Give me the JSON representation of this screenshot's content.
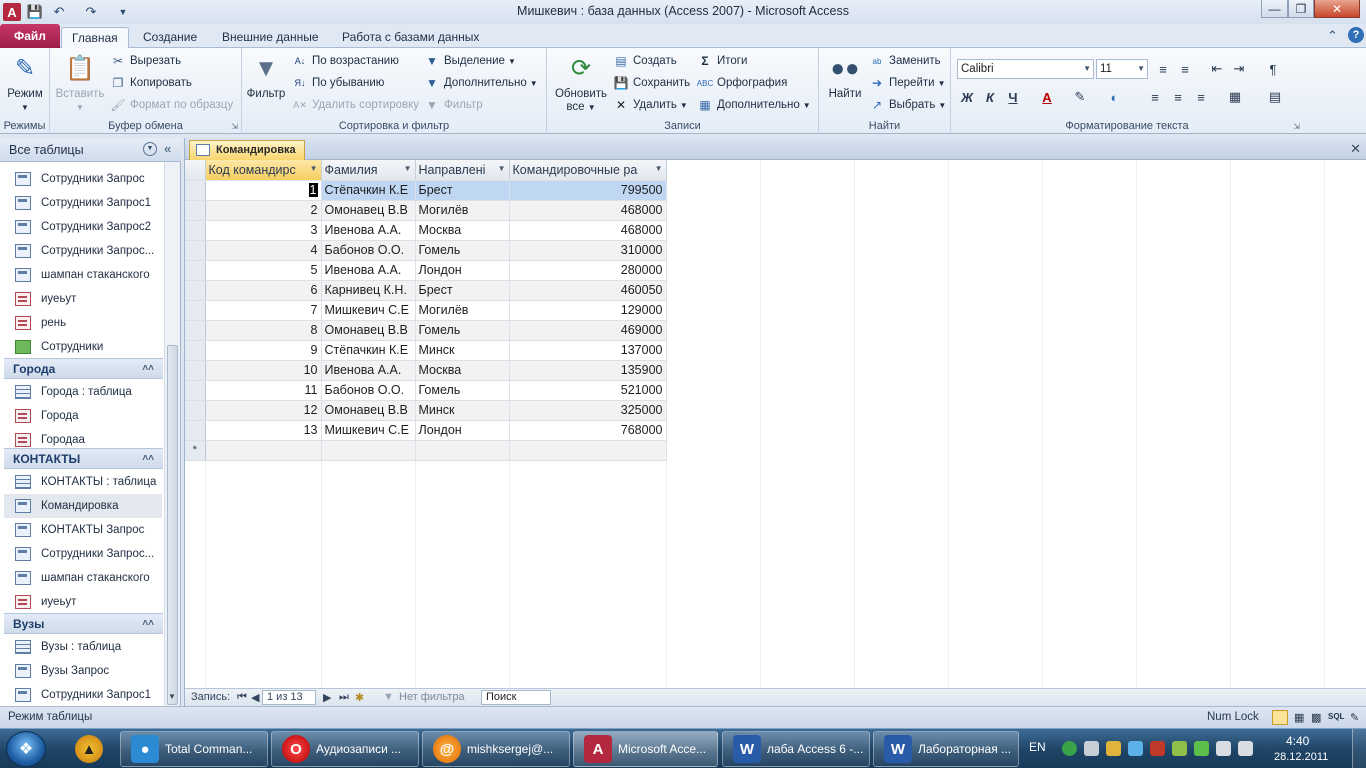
{
  "window": {
    "title": "Мишкевич : база данных (Access 2007)  -  Microsoft Access"
  },
  "tabs": [
    "Файл",
    "Главная",
    "Создание",
    "Внешние данные",
    "Работа с базами данных"
  ],
  "ribbon": {
    "groups": {
      "views": "Режимы",
      "clipboard": "Буфер обмена",
      "sort_filter": "Сортировка и фильтр",
      "records": "Записи",
      "find": "Найти",
      "text_format": "Форматирование текста"
    },
    "view_label": "Режим",
    "paste_label": "Вставить",
    "cut_label": "Вырезать",
    "copy_label": "Копировать",
    "format_painter_label": "Формат по образцу",
    "filter_label": "Фильтр",
    "ascending_label": "По возрастанию",
    "descending_label": "По убыванию",
    "remove_sort_label": "Удалить сортировку",
    "selection_label": "Выделение",
    "advanced_filter_label": "Дополнительно",
    "toggle_filter_label": "Фильтр",
    "refresh_label": "Обновить",
    "refresh_label2": "все",
    "new_label": "Создать",
    "save_label": "Сохранить",
    "delete_label": "Удалить",
    "totals_label": "Итоги",
    "spelling_label": "Орфография",
    "more_label": "Дополнительно",
    "find_label": "Найти",
    "replace_label": "Заменить",
    "goto_label": "Перейти",
    "select_label": "Выбрать",
    "font_name": "Calibri",
    "font_size": "11",
    "bold": "Ж",
    "italic": "К",
    "underline": "Ч",
    "font_color": "A"
  },
  "nav": {
    "header": "Все таблицы",
    "items_top": [
      {
        "label": "Сотрудники Запрос",
        "icon": "query"
      },
      {
        "label": "Сотрудники Запрос1",
        "icon": "query"
      },
      {
        "label": "Сотрудники Запрос2",
        "icon": "query"
      },
      {
        "label": "Сотрудники Запрос...",
        "icon": "query"
      },
      {
        "label": "шампан стаканского",
        "icon": "query"
      },
      {
        "label": "иуеьут",
        "icon": "form"
      },
      {
        "label": "рень",
        "icon": "form"
      },
      {
        "label": "Сотрудники",
        "icon": "report"
      }
    ],
    "group_goroda": "Города",
    "items_goroda": [
      {
        "label": "Города : таблица",
        "icon": "table"
      },
      {
        "label": "Города",
        "icon": "form"
      },
      {
        "label": "Городаа",
        "icon": "form"
      }
    ],
    "group_kontakty": "КОНТАКТЫ",
    "items_kontakty": [
      {
        "label": "КОНТАКТЫ : таблица",
        "icon": "table"
      },
      {
        "label": "Командировка",
        "icon": "query"
      },
      {
        "label": "КОНТАКТЫ Запрос",
        "icon": "query"
      },
      {
        "label": "Сотрудники Запрос...",
        "icon": "query"
      },
      {
        "label": "шампан стаканского",
        "icon": "query"
      },
      {
        "label": "иуеьут",
        "icon": "form"
      }
    ],
    "group_vuzy": "Вузы",
    "items_vuzy": [
      {
        "label": "Вузы : таблица",
        "icon": "table"
      },
      {
        "label": "Вузы Запрос",
        "icon": "query"
      },
      {
        "label": "Сотрудники Запрос1",
        "icon": "query"
      }
    ]
  },
  "doc": {
    "tab_title": "Командировка",
    "columns": [
      "Код командирс",
      "Фамилия",
      "Направлені",
      "Командировочные ра"
    ],
    "rows": [
      [
        "1",
        "Стёпачкин К.Е",
        "Брест",
        "799500"
      ],
      [
        "2",
        "Омонавец В.В",
        "Могилёв",
        "468000"
      ],
      [
        "3",
        "Ивенова А.А.",
        "Москва",
        "468000"
      ],
      [
        "4",
        "Бабонов О.О.",
        "Гомель",
        "310000"
      ],
      [
        "5",
        "Ивенова А.А.",
        "Лондон",
        "280000"
      ],
      [
        "6",
        "Карнивец К.Н.",
        "Брест",
        "460050"
      ],
      [
        "7",
        "Мишкевич С.Е",
        "Могилёв",
        "129000"
      ],
      [
        "8",
        "Омонавец В.В",
        "Гомель",
        "469000"
      ],
      [
        "9",
        "Стёпачкин К.Е",
        "Минск",
        "137000"
      ],
      [
        "10",
        "Ивенова А.А.",
        "Москва",
        "135900"
      ],
      [
        "11",
        "Бабонов О.О.",
        "Гомель",
        "521000"
      ],
      [
        "12",
        "Омонавец В.В",
        "Минск",
        "325000"
      ],
      [
        "13",
        "Мишкевич С.Е",
        "Лондон",
        "768000"
      ]
    ],
    "new_row_marker": "*"
  },
  "recordbar": {
    "label": "Запись:",
    "position": "1 из 13",
    "no_filter": "Нет фильтра",
    "search": "Поиск"
  },
  "status": {
    "left": "Режим таблицы",
    "numlock": "Num Lock"
  },
  "taskbar": {
    "items": [
      "Total Comman...",
      "Аудиозаписи ...",
      "mishksergej@...",
      "Microsoft Acce...",
      "лаба Access 6 -...",
      "Лабораторная ..."
    ],
    "lang": "EN",
    "time": "4:40",
    "date": "28.12.2011"
  }
}
